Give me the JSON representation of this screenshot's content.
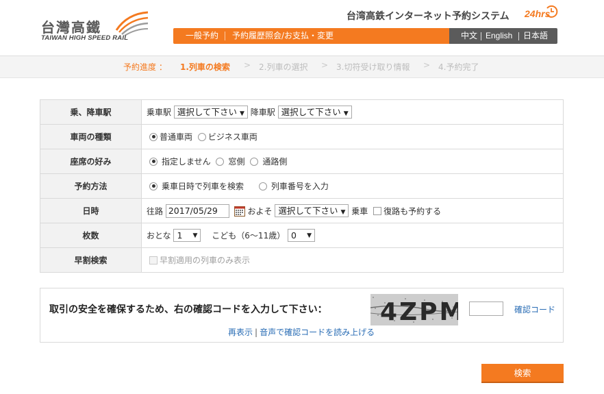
{
  "header": {
    "logo_cn": "台灣高鐵",
    "logo_en": "TAIWAN HIGH SPEED RAIL",
    "system_title": "台湾高鉄インターネット予約システム",
    "badge_24": "24hrs",
    "nav": [
      {
        "label": "一般予約"
      },
      {
        "label": "予約履歴照会/お支払・変更"
      }
    ],
    "languages": [
      {
        "label": "中文"
      },
      {
        "label": "English"
      },
      {
        "label": "日本語"
      }
    ]
  },
  "progress": {
    "label": "予約進度 ：",
    "steps": [
      {
        "label": "1.列車の検索",
        "active": true
      },
      {
        "label": "2.列車の選択",
        "active": false
      },
      {
        "label": "3.切符受け取り情報",
        "active": false
      },
      {
        "label": "4.予約完了",
        "active": false
      }
    ],
    "arrow": ">"
  },
  "form": {
    "station": {
      "label": "乗、降車駅",
      "depart_label": "乗車駅",
      "depart_value": "選択して下さい",
      "arrive_label": "降車駅",
      "arrive_value": "選択して下さい"
    },
    "car_type": {
      "label": "車両の種類",
      "options": [
        "普通車両",
        "ビジネス車両"
      ],
      "selected": 0
    },
    "seat_pref": {
      "label": "座席の好み",
      "options": [
        "指定しません",
        "窓側",
        "通路側"
      ],
      "selected": 0
    },
    "method": {
      "label": "予約方法",
      "options": [
        "乗車日時で列車を検索",
        "列車番号を入力"
      ],
      "selected": 0
    },
    "date": {
      "label": "日時",
      "outbound_label": "往路",
      "date_value": "2017/05/29",
      "approx_label": "およそ",
      "time_value": "選択して下さい",
      "board_label": "乗車",
      "return_label": "復路も予約する"
    },
    "tickets": {
      "label": "枚数",
      "adult_label": "おとな",
      "adult_value": "1",
      "child_label": "こども（6〜11歳）",
      "child_value": "0"
    },
    "early": {
      "label": "早割検索",
      "option_label": "早割適用の列車のみ表示"
    }
  },
  "captcha": {
    "prompt": "取引の安全を確保するため、右の確認コードを入力して下さい：",
    "image_text": "4ZPM",
    "input_value": "",
    "link_label": "確認コード",
    "refresh_label": "再表示",
    "separator": "|",
    "audio_label": "音声で確認コードを読み上げる"
  },
  "search_button": {
    "label": "検索"
  },
  "colors": {
    "accent": "#f47a20",
    "lang_bar": "#5b5b5b",
    "link": "#2a6db5"
  }
}
